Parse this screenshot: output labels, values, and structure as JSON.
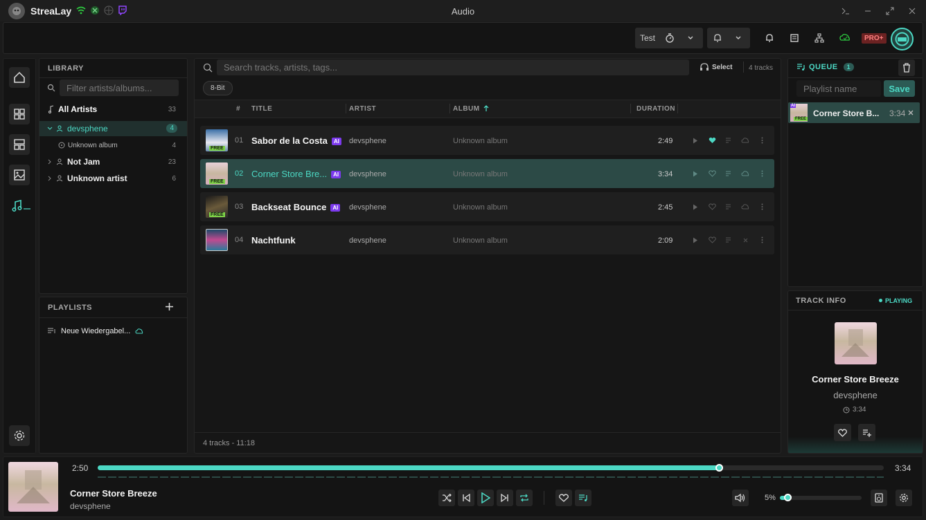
{
  "app": {
    "name": "StreaLay",
    "window_title": "Audio"
  },
  "topbar": {
    "profile_label": "Test",
    "pro_badge": "PRO+"
  },
  "library": {
    "header": "LIBRARY",
    "filter_placeholder": "Filter artists/albums...",
    "all_artists": {
      "label": "All Artists",
      "count": "33"
    },
    "artists": [
      {
        "label": "devsphene",
        "count": "4"
      },
      {
        "label": "Unknown album",
        "count": "4"
      },
      {
        "label": "Not Jam",
        "count": "23"
      },
      {
        "label": "Unknown artist",
        "count": "6"
      }
    ]
  },
  "playlists": {
    "header": "PLAYLISTS",
    "items": [
      {
        "label": "Neue Wiedergabel..."
      }
    ]
  },
  "tracks": {
    "search_placeholder": "Search tracks, artists, tags...",
    "select_label": "Select",
    "count_label": "4 tracks",
    "tag": "8-Bit",
    "columns": {
      "num": "#",
      "title": "TITLE",
      "artist": "ARTIST",
      "album": "ALBUM",
      "duration": "DURATION"
    },
    "rows": [
      {
        "num": "01",
        "title": "Sabor de la Costa",
        "ai": "AI",
        "free": "FREE",
        "artist": "devsphene",
        "album": "Unknown album",
        "duration": "2:49"
      },
      {
        "num": "02",
        "title": "Corner Store Bre...",
        "ai": "AI",
        "free": "FREE",
        "artist": "devsphene",
        "album": "Unknown album",
        "duration": "3:34"
      },
      {
        "num": "03",
        "title": "Backseat Bounce",
        "ai": "AI",
        "free": "FREE",
        "artist": "devsphene",
        "album": "Unknown album",
        "duration": "2:45"
      },
      {
        "num": "04",
        "title": "Nachtfunk",
        "ai": "",
        "free": "",
        "artist": "devsphene",
        "album": "Unknown album",
        "duration": "2:09"
      }
    ],
    "footer": "4 tracks - 11:18"
  },
  "queue": {
    "header": "QUEUE",
    "count": "1",
    "playlist_placeholder": "Playlist name",
    "save_label": "Save",
    "items": [
      {
        "title": "Corner Store B...",
        "duration": "3:34",
        "ai": "AI",
        "free": "FREE"
      }
    ]
  },
  "track_info": {
    "header": "TRACK INFO",
    "status": "PLAYING",
    "title": "Corner Store Breeze",
    "artist": "devsphene",
    "duration": "3:34"
  },
  "player": {
    "elapsed": "2:50",
    "total": "3:34",
    "progress": 0.79,
    "title": "Corner Store Breeze",
    "artist": "devsphene",
    "volume_label": "5%",
    "volume": 0.05
  },
  "colors": {
    "accent": "#4cd8c4",
    "ai_badge": "#7c3aed",
    "free_badge": "#7ed348",
    "active_row": "#2c4a46"
  }
}
